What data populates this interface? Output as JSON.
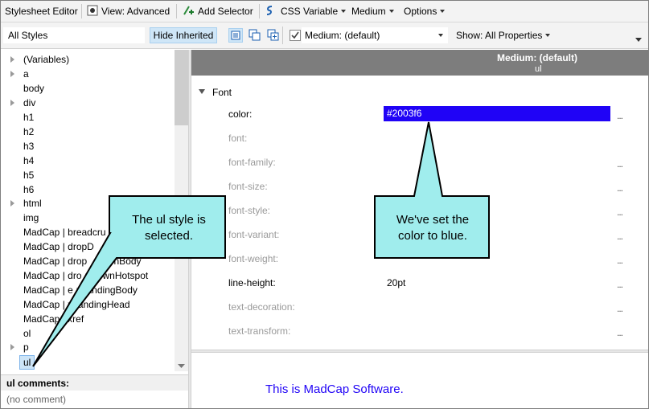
{
  "toolbar": {
    "title": "Stylesheet Editor",
    "view": "View: Advanced",
    "add_selector": "Add Selector",
    "css_variable": "CSS Variable",
    "medium": "Medium",
    "options": "Options"
  },
  "toolbar2": {
    "styles_filter": "All Styles",
    "hide_inherited": "Hide Inherited",
    "medium_select": "Medium: (default)",
    "show_filter": "Show: All Properties"
  },
  "tree": {
    "items": [
      "(Variables)",
      "a",
      "body",
      "div",
      "h1",
      "h2",
      "h3",
      "h4",
      "h5",
      "h6",
      "html",
      "img",
      "MadCap | breadcru",
      "MadCap | dropD",
      "MadCap | drop",
      "MadCap | dro",
      "MadCap | e",
      "MadCap | ",
      "MadCap | xref",
      "ol",
      "p",
      "ul"
    ],
    "item_tails": {
      "dropDownBody": "ownBody",
      "dropDownHotspot": "pDownHotspot",
      "expandingBody": "xpandingBody",
      "expandingHead": "xpandingHead"
    },
    "selected": "ul"
  },
  "comments": {
    "header": "ul comments:",
    "value": "(no comment)"
  },
  "grid": {
    "header_medium": "Medium: (default)",
    "header_selector": "ul",
    "group": "Font",
    "properties": [
      "color:",
      "font:",
      "font-family:",
      "font-size:",
      "font-style:",
      "font-variant:",
      "font-weight:",
      "line-height:",
      "text-decoration:",
      "text-transform:"
    ],
    "color_value": "#2003f6",
    "line_height_value": "20pt",
    "dots": "..."
  },
  "preview": {
    "text": "This is MadCap Software."
  },
  "callouts": {
    "left": "The ul style is selected.",
    "right": "We've set the color to blue."
  },
  "colors": {
    "accent_blue": "#2003f6",
    "callout_fill": "#a0eded",
    "header_gray": "#7d7d7d",
    "selection": "#cce4f7"
  }
}
